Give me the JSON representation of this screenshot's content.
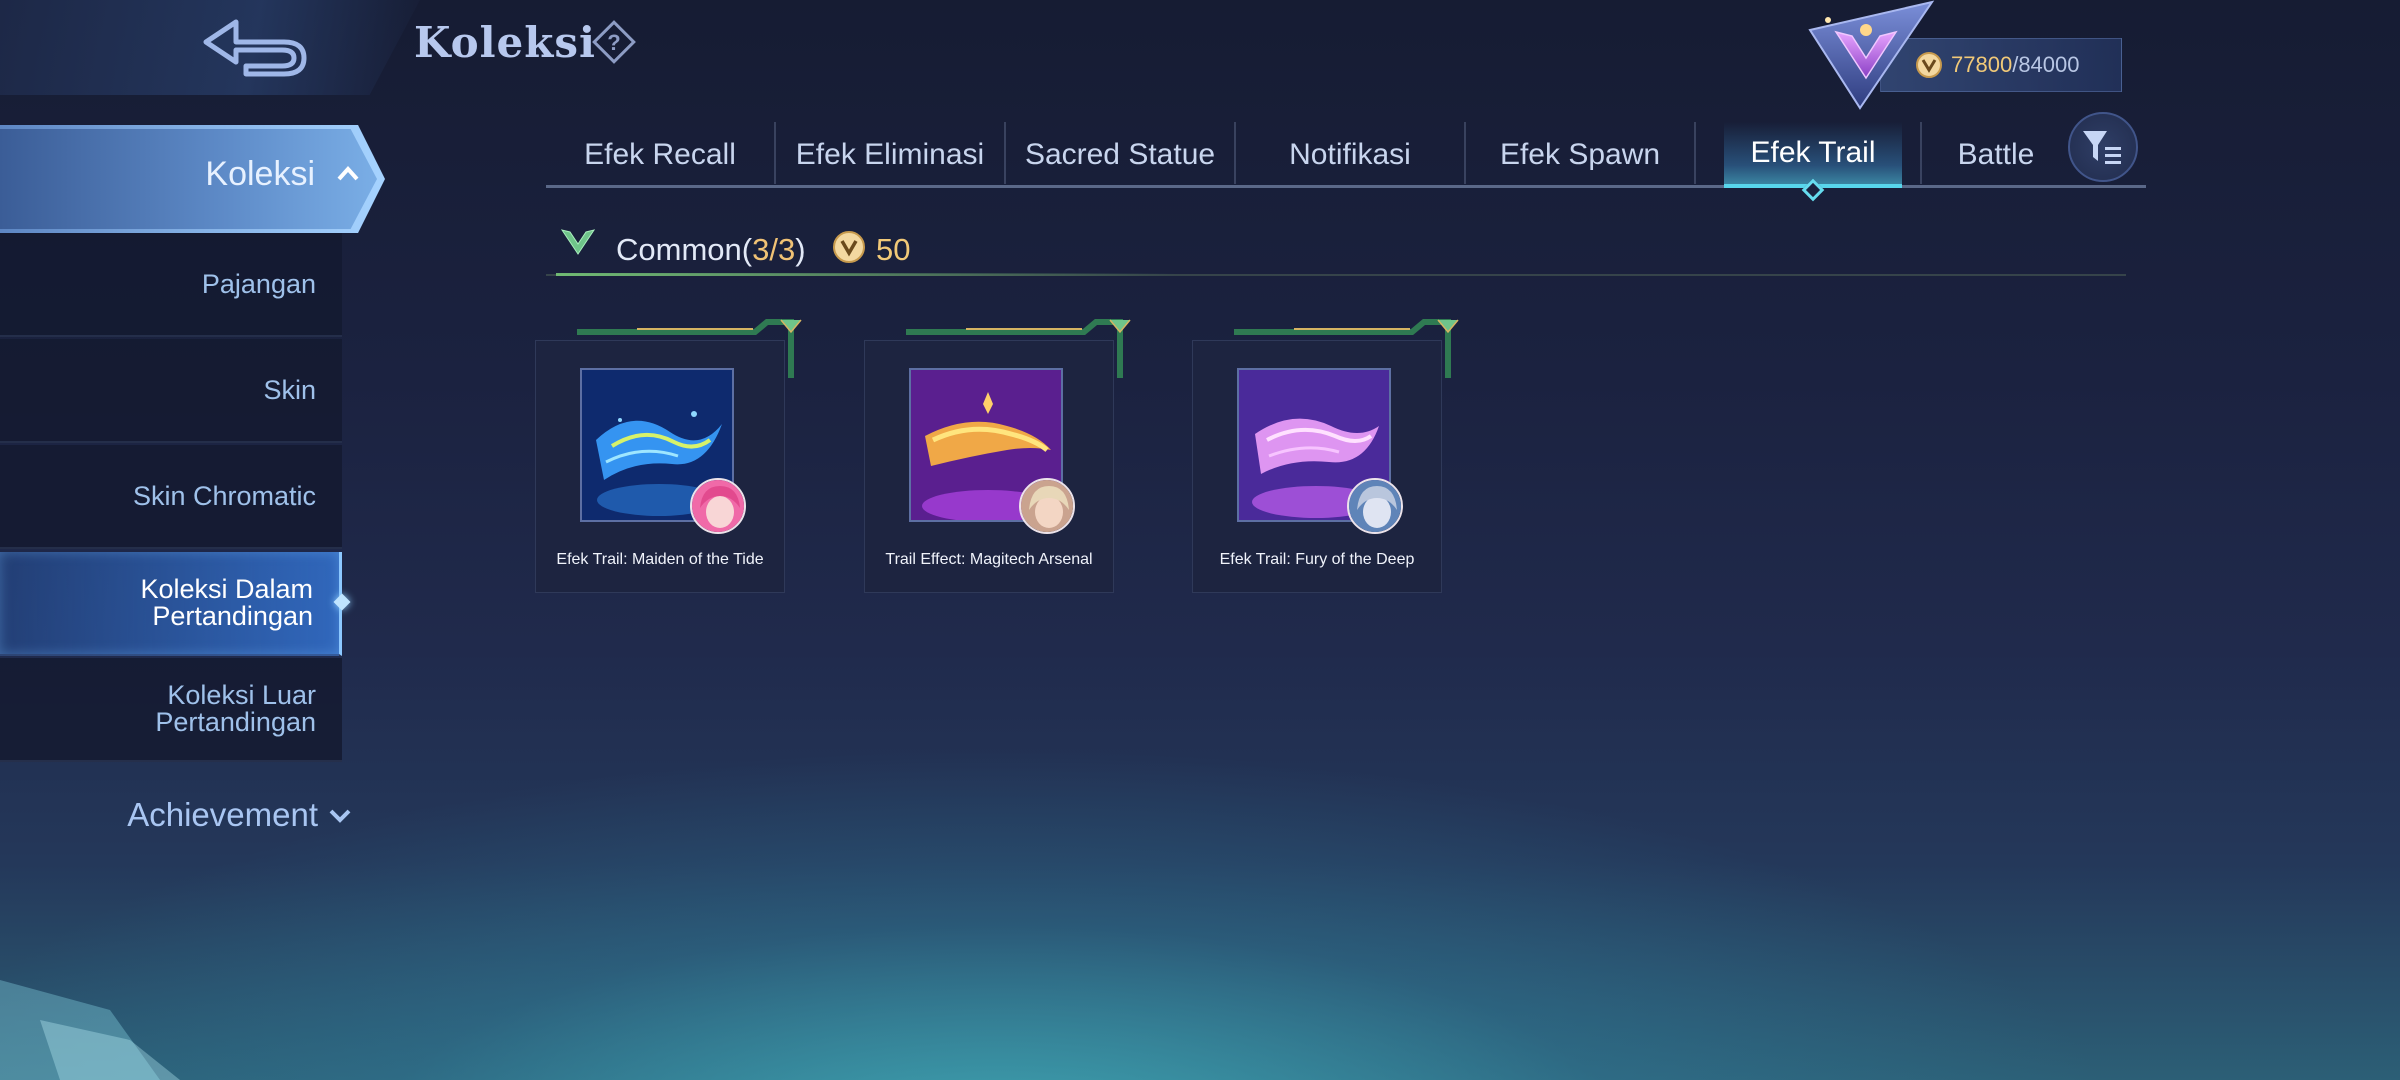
{
  "header": {
    "title": "Koleksi",
    "back_icon": "back-arrow-icon",
    "help_icon": "help-icon"
  },
  "currency": {
    "current": "77800",
    "separator": "/",
    "max": "84000",
    "icon": "collection-coin-icon"
  },
  "sidebar": {
    "section_label": "Koleksi",
    "items": [
      {
        "label": "Pajangan"
      },
      {
        "label": "Skin"
      },
      {
        "label": "Skin Chromatic"
      },
      {
        "label_line1": "Koleksi Dalam",
        "label_line2": "Pertandingan"
      },
      {
        "label_line1": "Koleksi Luar",
        "label_line2": "Pertandingan"
      }
    ],
    "active_index": 3,
    "achievement_label": "Achievement"
  },
  "tabs": {
    "items": [
      {
        "label": "Efek Recall"
      },
      {
        "label": "Efek Eliminasi"
      },
      {
        "label": "Sacred Statue"
      },
      {
        "label": "Notifikasi"
      },
      {
        "label": "Efek Spawn"
      },
      {
        "label": "Efek Trail"
      },
      {
        "label": "Battle"
      }
    ],
    "active_index": 5,
    "filter_icon": "filter-icon"
  },
  "rarity_group": {
    "label": "Common",
    "count_open": "(",
    "count": "3/3",
    "count_close": ")",
    "points": "50",
    "accent_color": "#6fc48a"
  },
  "cards": [
    {
      "title": "Efek Trail: Maiden of the Tide",
      "theme": "blue-wave",
      "avatar": "pink-hair-hero"
    },
    {
      "title": "Trail Effect: Magitech Arsenal",
      "theme": "purple-gold-wave",
      "avatar": "blonde-hero"
    },
    {
      "title": "Efek Trail: Fury of the Deep",
      "theme": "violet-wave",
      "avatar": "silver-hair-hero"
    }
  ],
  "colors": {
    "active_tab_accent": "#58d6ec",
    "currency_gold": "#f1c978",
    "sidebar_active": "#8cc8ff"
  }
}
